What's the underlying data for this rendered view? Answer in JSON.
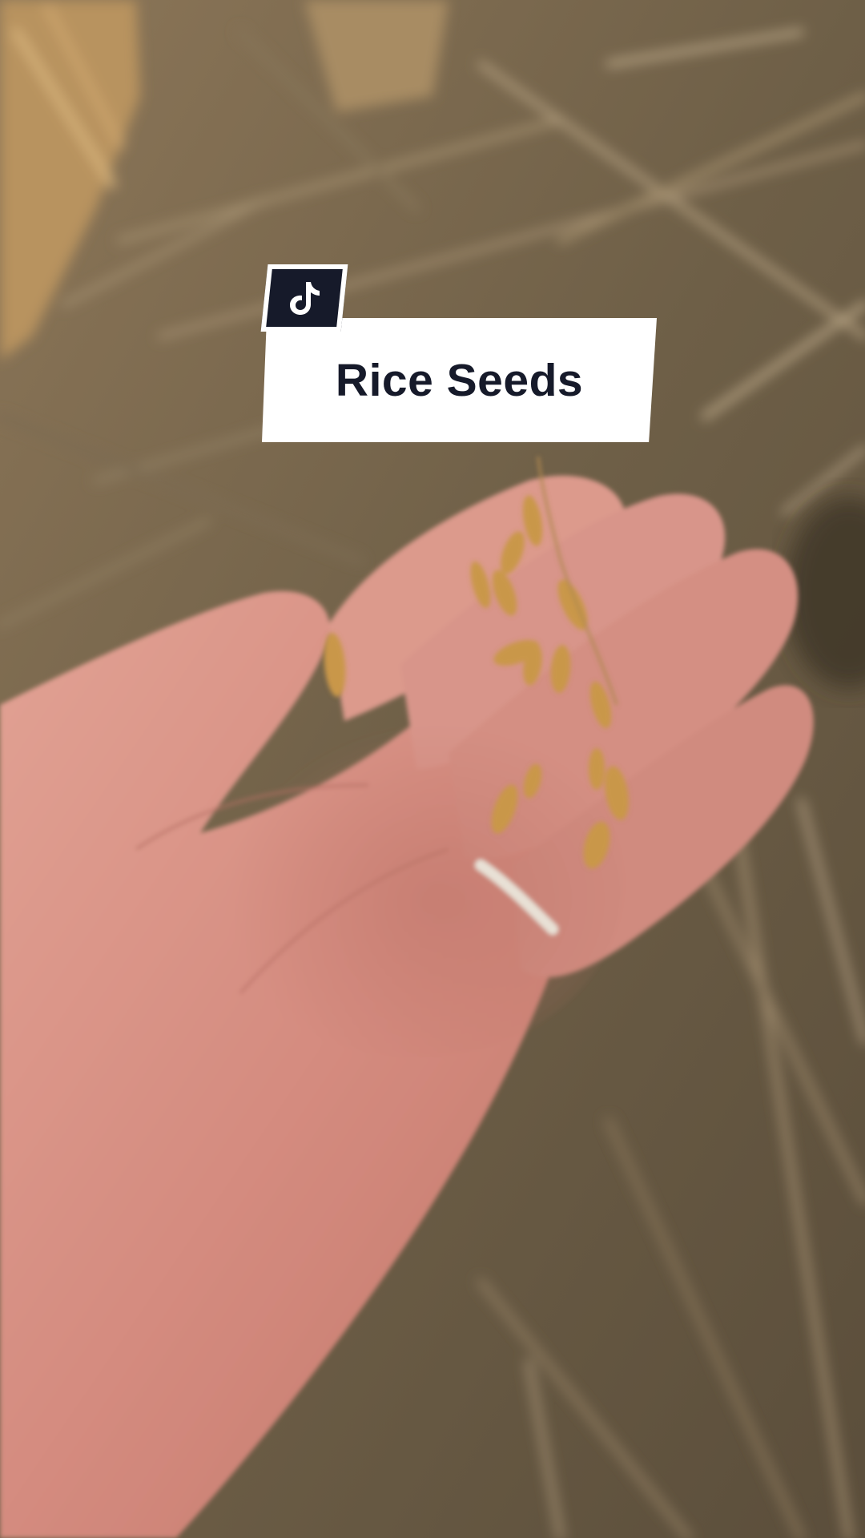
{
  "overlay": {
    "logo_icon": "tiktok-icon",
    "title": "Rice Seeds"
  },
  "colors": {
    "badge_background": "#161a2a",
    "card_background": "#ffffff",
    "title_text": "#161a2a"
  }
}
